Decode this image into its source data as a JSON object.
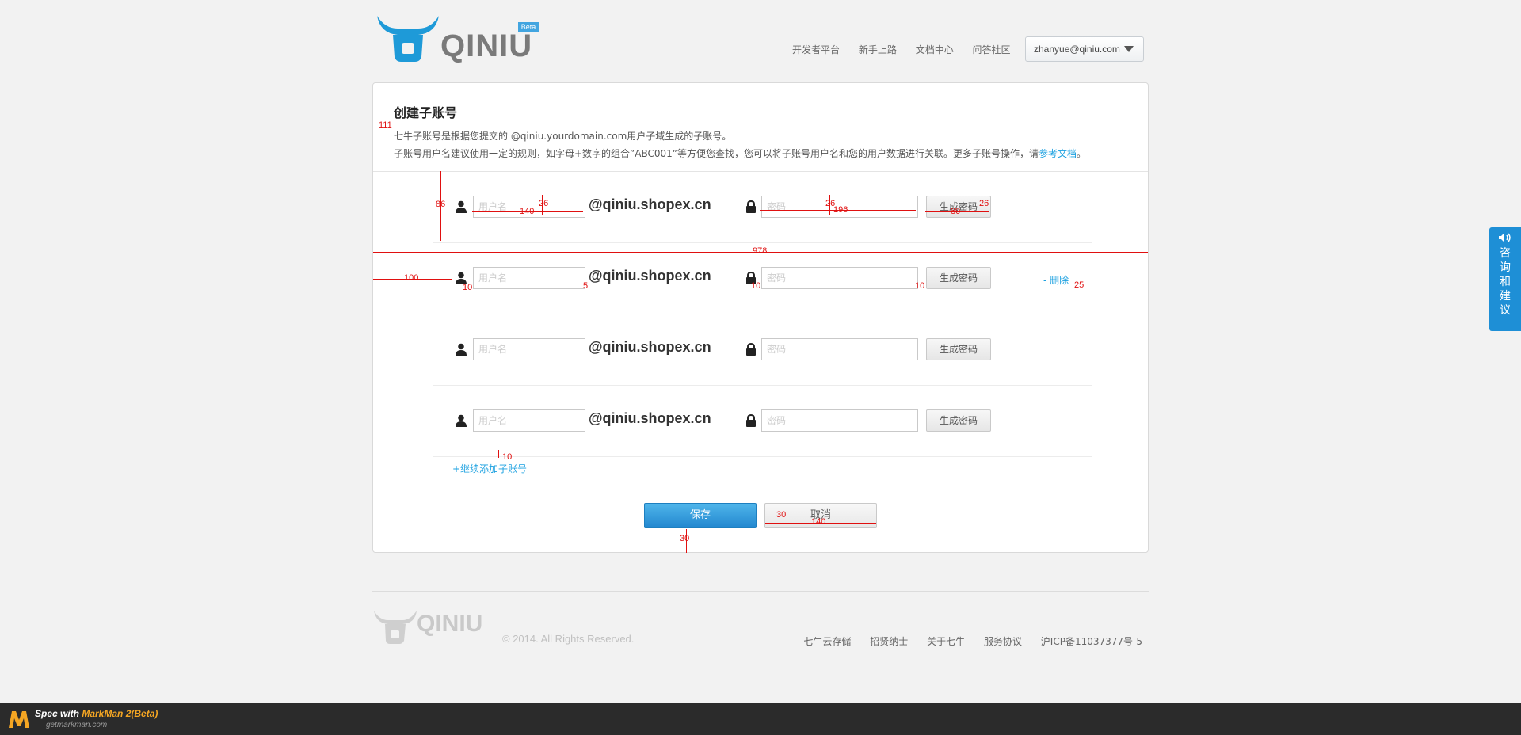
{
  "header": {
    "logo_text": "QINIU",
    "beta_badge": "Beta",
    "nav": [
      "开发者平台",
      "新手上路",
      "文档中心",
      "问答社区"
    ],
    "account": "zhanyue@qiniu.com"
  },
  "form": {
    "title": "创建子账号",
    "desc_line1": "七牛子账号是根据您提交的 @qiniu.yourdomain.com用户子域生成的子账号。",
    "desc_line2_prefix": "子账号用户名建议使用一定的规则，如字母+数字的组合”ABC001”等方便您查找，您可以将子账号用户名和您的用户数据进行关联。更多子账号操作，请",
    "desc_link": "参考文档",
    "desc_suffix": "。",
    "username_placeholder": "用户名",
    "password_placeholder": "密码",
    "domain_suffix": "@qiniu.shopex.cn",
    "generate_label": "生成密码",
    "delete_label": "- 删除",
    "add_more": "+继续添加子账号",
    "save_label": "保存",
    "cancel_label": "取消"
  },
  "spec": {
    "header_height": "111",
    "row_height": "86",
    "input_height": "26",
    "input_width": "140",
    "pwd_height": "26",
    "pwd_width": "196",
    "btn_height": "26",
    "btn_width": "80",
    "card_width": "978",
    "left_offset": "100",
    "icon_gap": "10",
    "domain_gap": "5",
    "lock_gap": "10",
    "btn_gap": "10",
    "delete_gap": "25",
    "add_gap": "10",
    "cancel_height": "30",
    "cancel_width": "140",
    "bottom_gap": "30"
  },
  "footer": {
    "logo_text": "QINIU",
    "copyright": "© 2014. All Rights Reserved.",
    "links": [
      "七牛云存储",
      "招贤纳士",
      "关于七牛",
      "服务协议",
      "沪ICP备11037377号-5"
    ]
  },
  "feedback": {
    "label": "咨询和建议"
  },
  "markman": {
    "prefix": "Spec with ",
    "brand": "MarkMan 2(Beta)",
    "site": "getmarkman.com"
  },
  "colors": {
    "accent": "#1aa0e0",
    "spec": "#e01010",
    "feedback": "#1e8fd6"
  }
}
